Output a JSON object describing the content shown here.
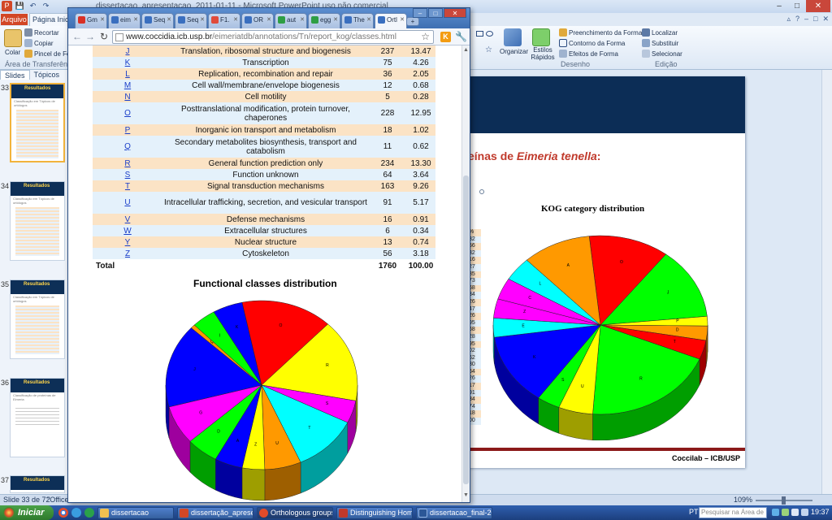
{
  "ppt": {
    "title": "dissertacao_apresentacao_2011-01-11 - Microsoft PowerPoint uso não comercial",
    "tab_file": "Arquivo",
    "tab_home": "Página Inicial",
    "clipboard": {
      "paste": "Colar",
      "cut": "Recortar",
      "copy": "Copiar",
      "format_painter": "Pincel de Formatação",
      "group": "Área de Transferência"
    },
    "drawing": {
      "arrange": "Organizar",
      "quick_styles": "Estilos Rápidos",
      "fill": "Preenchimento da Forma",
      "outline": "Contorno da Forma",
      "effects": "Efeitos de Forma",
      "group": "Desenho"
    },
    "editing": {
      "find": "Localizar",
      "replace": "Substituir",
      "select": "Selecionar",
      "group": "Edição"
    },
    "panel_tabs": [
      "Slides",
      "Tópicos"
    ],
    "thumbs": [
      {
        "num": "33",
        "title": "Resultados",
        "sub": "Classificação em Tópicos de ortólogos"
      },
      {
        "num": "34",
        "title": "Resultados",
        "sub": "Classificação em Tópicos de ortólogos"
      },
      {
        "num": "35",
        "title": "Resultados",
        "sub": "Classificação em Tópicos de ortólogos"
      },
      {
        "num": "36",
        "title": "Resultados",
        "sub": "Classificação de proteínas de Eimeria"
      },
      {
        "num": "37",
        "title": "Resultados",
        "sub": ""
      }
    ],
    "slide": {
      "title_prefix": "eínas de ",
      "title_em": "Eimeria tenella",
      "title_suffix": ":",
      "chart_title": "KOG category distribution",
      "footer": "Coccilab – ICB/USP",
      "ycol": [
        "%",
        "32",
        "56",
        "32",
        "16",
        "27",
        "85",
        "73",
        "68",
        "34",
        "26",
        "47",
        "26",
        "95",
        "68",
        "28",
        "95",
        "02",
        "",
        "62",
        "",
        "30",
        "64",
        "26",
        "17",
        "91",
        "34",
        "74",
        "18",
        "00"
      ]
    },
    "status": {
      "slide": "Slide 33 de 72",
      "theme": "\"Office\"",
      "zoom": "109%"
    }
  },
  "chrome": {
    "tabs": [
      {
        "label": "Gm",
        "color": "#d93025"
      },
      {
        "label": "eim",
        "color": "#3a6fbf"
      },
      {
        "label": "Seq",
        "color": "#3a6fbf"
      },
      {
        "label": "Seq",
        "color": "#3a6fbf"
      },
      {
        "label": "F1.",
        "color": "#e04a3a"
      },
      {
        "label": "OR",
        "color": "#3a6fbf"
      },
      {
        "label": "aut",
        "color": "#2e9e44"
      },
      {
        "label": "egg",
        "color": "#2e9e44"
      },
      {
        "label": "The",
        "color": "#3a6fbf"
      },
      {
        "label": "Ortl",
        "color": "#3a6fbf"
      }
    ],
    "url_host": "www.coccidia.icb.usp.br",
    "url_path": "/eimeriatdb/annotations/Tn/report_kog/classes.html",
    "ext_label": "K",
    "kog_rows": [
      {
        "code": "J",
        "desc": "Translation, ribosomal structure and biogenesis",
        "count": "237",
        "pct": "13.47"
      },
      {
        "code": "K",
        "desc": "Transcription",
        "count": "75",
        "pct": "4.26"
      },
      {
        "code": "L",
        "desc": "Replication, recombination and repair",
        "count": "36",
        "pct": "2.05"
      },
      {
        "code": "M",
        "desc": "Cell wall/membrane/envelope biogenesis",
        "count": "12",
        "pct": "0.68"
      },
      {
        "code": "N",
        "desc": "Cell motility",
        "count": "5",
        "pct": "0.28"
      },
      {
        "code": "O",
        "desc": "Posttranslational modification, protein turnover, chaperones",
        "count": "228",
        "pct": "12.95"
      },
      {
        "code": "P",
        "desc": "Inorganic ion transport and metabolism",
        "count": "18",
        "pct": "1.02"
      },
      {
        "code": "Q",
        "desc": "Secondary metabolites biosynthesis, transport and catabolism",
        "count": "11",
        "pct": "0.62"
      },
      {
        "code": "R",
        "desc": "General function prediction only",
        "count": "234",
        "pct": "13.30"
      },
      {
        "code": "S",
        "desc": "Function unknown",
        "count": "64",
        "pct": "3.64"
      },
      {
        "code": "T",
        "desc": "Signal transduction mechanisms",
        "count": "163",
        "pct": "9.26"
      },
      {
        "code": "U",
        "desc": "Intracellular trafficking, secretion, and vesicular transport",
        "count": "91",
        "pct": "5.17"
      },
      {
        "code": "V",
        "desc": "Defense mechanisms",
        "count": "16",
        "pct": "0.91"
      },
      {
        "code": "W",
        "desc": "Extracellular structures",
        "count": "6",
        "pct": "0.34"
      },
      {
        "code": "Y",
        "desc": "Nuclear structure",
        "count": "13",
        "pct": "0.74"
      },
      {
        "code": "Z",
        "desc": "Cytoskeleton",
        "count": "56",
        "pct": "3.18"
      }
    ],
    "total": {
      "label": "Total",
      "count": "1760",
      "pct": "100.00"
    },
    "chart_title": "Functional classes distribution"
  },
  "chart_data": [
    {
      "type": "pie",
      "title": "Functional classes distribution",
      "labels": [
        "K",
        "O",
        "R",
        "S",
        "T",
        "U",
        "Z",
        "A",
        "D",
        "G",
        "J",
        "Q",
        "I"
      ],
      "values": [
        75,
        228,
        234,
        64,
        163,
        91,
        56,
        70,
        80,
        110,
        237,
        11,
        60
      ],
      "colors": [
        "#0000ff",
        "#ff0000",
        "#ffff00",
        "#ff00ff",
        "#00ffff",
        "#ff9900",
        "#ffff00",
        "#0000ff",
        "#00ff00",
        "#ff00ff",
        "#0000ff",
        "#ff9900",
        "#00ff00"
      ]
    },
    {
      "type": "pie",
      "title": "KOG category distribution",
      "labels": [
        "O",
        "J",
        "P",
        "D",
        "T",
        "R",
        "U",
        "S",
        "K",
        "E",
        "Z",
        "C",
        "L",
        "A"
      ],
      "values": [
        140,
        150,
        20,
        30,
        40,
        230,
        60,
        40,
        150,
        40,
        40,
        45,
        50,
        120
      ],
      "colors": [
        "#ff0000",
        "#00ff00",
        "#ffff00",
        "#ff9900",
        "#ff0000",
        "#00ff00",
        "#ffff00",
        "#00ff00",
        "#0000ff",
        "#00ffff",
        "#ff00ff",
        "#ff00ff",
        "#00ffff",
        "#ff9900"
      ]
    }
  ],
  "taskbar": {
    "start": "Iniciar",
    "items": [
      "dissertacao",
      "dissertação_apresent...",
      "Orthologous groups r...",
      "Distinguishing Homolo...",
      "dissertacao_final-201..."
    ],
    "lang": "PT",
    "search_placeholder": "Pesquisar na Área de",
    "clock": "19:37"
  }
}
